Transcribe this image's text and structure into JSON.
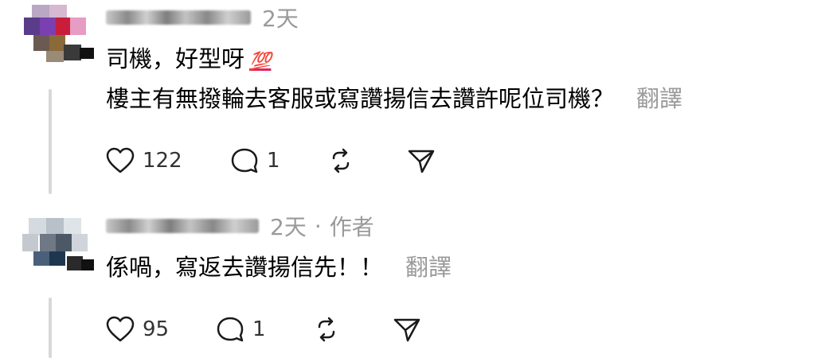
{
  "comments": [
    {
      "timestamp": "2天",
      "lines": [
        "司機，好型呀",
        "樓主有無撥輪去客服或寫讚揚信去讚許呢位司機？"
      ],
      "emoji": "💯",
      "translate_label": "翻譯",
      "actions": {
        "like_count": "122",
        "reply_count": "1"
      }
    },
    {
      "timestamp": "2天",
      "separator": "·",
      "author_badge": "作者",
      "lines": [
        "係喎，寫返去讚揚信先！！"
      ],
      "translate_label": "翻譯",
      "actions": {
        "like_count": "95",
        "reply_count": "1"
      }
    }
  ],
  "icons": {
    "like": "heart-icon",
    "reply": "comment-bubble-icon",
    "repost": "repost-icon",
    "share": "send-icon"
  },
  "colors": {
    "text": "#000000",
    "meta": "#9a9a9a",
    "thread_line": "#d8d8d8",
    "emoji_100": "#e0245e"
  }
}
